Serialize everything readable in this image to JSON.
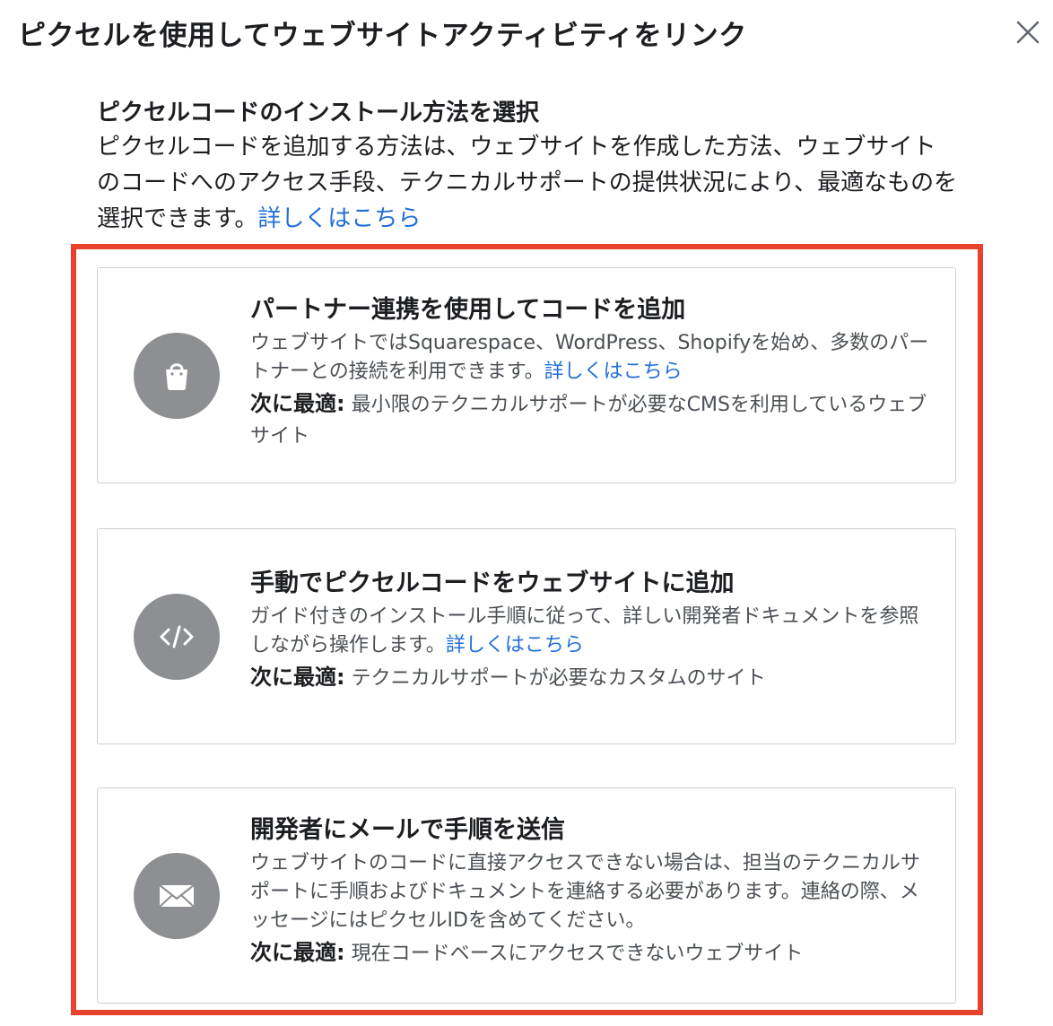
{
  "dialog": {
    "title": "ピクセルを使用してウェブサイトアクティビティをリンク",
    "close_icon": "close-icon"
  },
  "intro": {
    "heading": "ピクセルコードのインストール方法を選択",
    "body": "ピクセルコードを追加する方法は、ウェブサイトを作成した方法、ウェブサイトのコードへのアクセス手段、テクニカルサポートの提供状況により、最適なものを選択できます。",
    "learn_more": "詳しくはこちら"
  },
  "highlight_color": "#e8412c",
  "link_color": "#216fdb",
  "options": [
    {
      "icon": "shopping-bag-icon",
      "title": "パートナー連携を使用してコードを追加",
      "description": "ウェブサイトではSquarespace、WordPress、Shopifyを始め、多数のパートナーとの接続を利用できます。",
      "learn_more": "詳しくはこちら",
      "best_for_label": "次に最適:",
      "best_for_text": " 最小限のテクニカルサポートが必要なCMSを利用しているウェブサイト"
    },
    {
      "icon": "code-icon",
      "title": "手動でピクセルコードをウェブサイトに追加",
      "description": "ガイド付きのインストール手順に従って、詳しい開発者ドキュメントを参照しながら操作します。",
      "learn_more": "詳しくはこちら",
      "best_for_label": "次に最適:",
      "best_for_text": " テクニカルサポートが必要なカスタムのサイト"
    },
    {
      "icon": "envelope-icon",
      "title": "開発者にメールで手順を送信",
      "description": "ウェブサイトのコードに直接アクセスできない場合は、担当のテクニカルサポートに手順およびドキュメントを連絡する必要があります。連絡の際、メッセージにはピクセルIDを含めてください。",
      "best_for_label": "次に最適:",
      "best_for_text": " 現在コードベースにアクセスできないウェブサイト"
    }
  ]
}
